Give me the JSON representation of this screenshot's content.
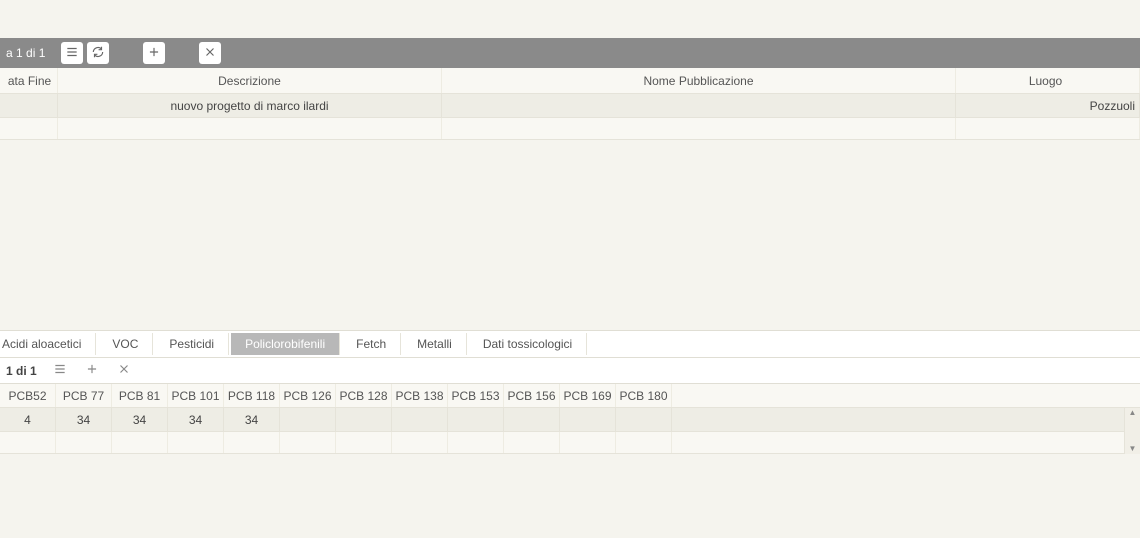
{
  "upper": {
    "pager": "a 1 di 1",
    "headers": {
      "dataFine": "ata Fine",
      "descrizione": "Descrizione",
      "nomePubblicazione": "Nome Pubblicazione",
      "luogo": "Luogo"
    },
    "row": {
      "dataFine": "",
      "descrizione": "nuovo progetto di marco ilardi",
      "nomePubblicazione": "",
      "luogo": "Pozzuoli"
    }
  },
  "tabs": [
    {
      "label": "Acidi aloacetici",
      "active": false
    },
    {
      "label": "VOC",
      "active": false
    },
    {
      "label": "Pesticidi",
      "active": false
    },
    {
      "label": "Policlorobifenili",
      "active": true
    },
    {
      "label": "Fetch",
      "active": false
    },
    {
      "label": "Metalli",
      "active": false
    },
    {
      "label": "Dati tossicologici",
      "active": false
    }
  ],
  "lower": {
    "pager": "1 di 1",
    "columns": [
      "PCB52",
      "PCB 77",
      "PCB 81",
      "PCB 101",
      "PCB 118",
      "PCB 126",
      "PCB 128",
      "PCB 138",
      "PCB 153",
      "PCB 156",
      "PCB 169",
      "PCB 180"
    ],
    "row": [
      "4",
      "34",
      "34",
      "34",
      "34",
      "",
      "",
      "",
      "",
      "",
      "",
      ""
    ]
  }
}
